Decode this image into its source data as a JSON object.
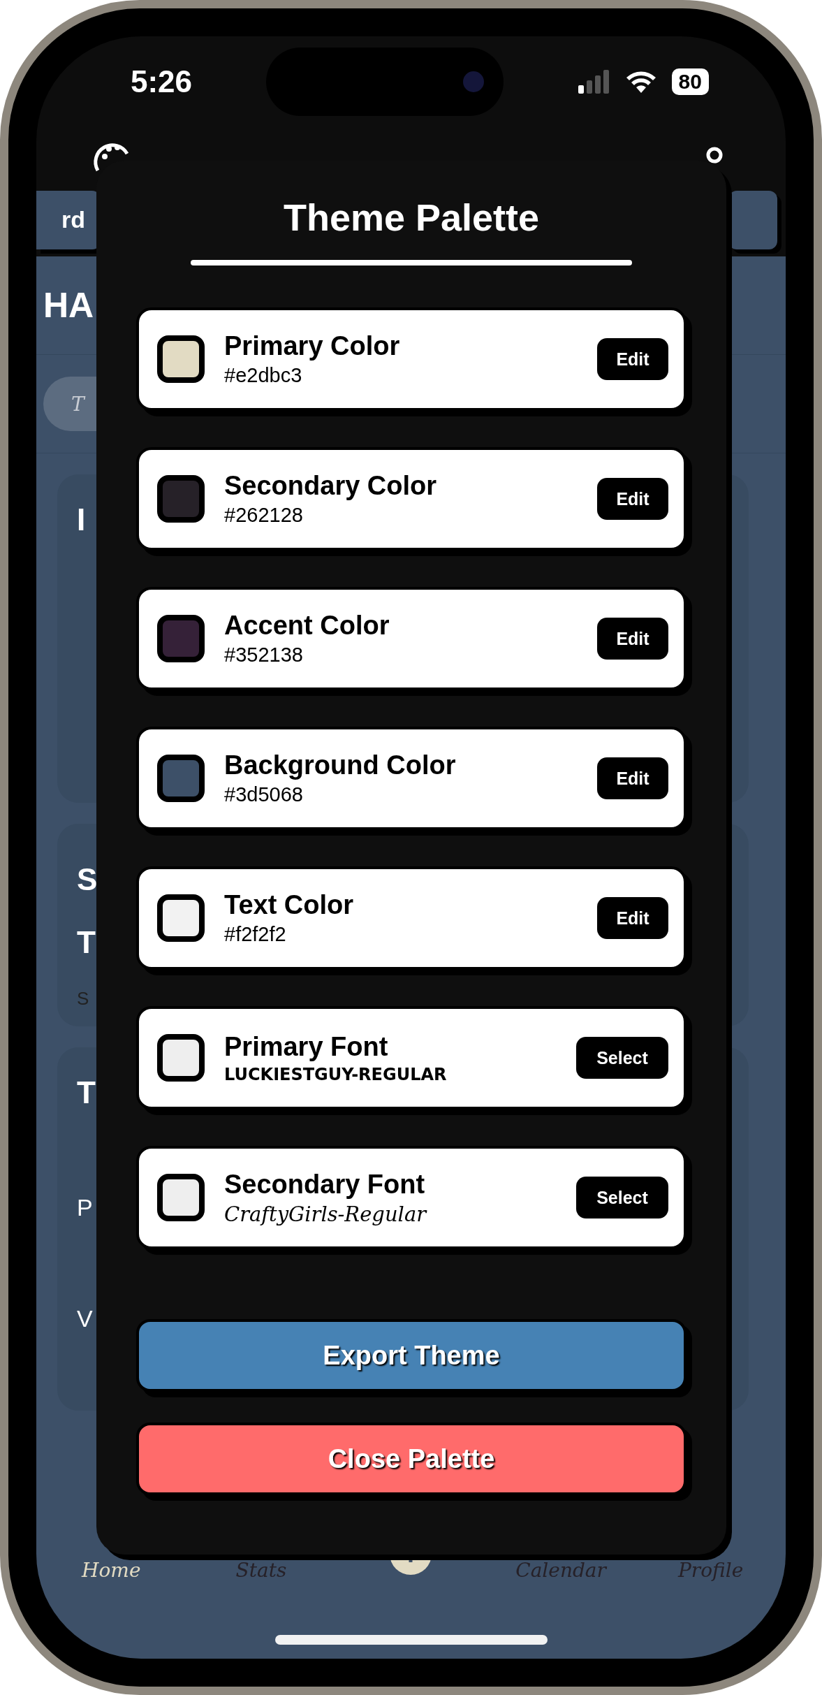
{
  "status_bar": {
    "time": "5:26",
    "battery": "80"
  },
  "background": {
    "chip_left": "rd",
    "heading": "HA",
    "search_fragment": "T",
    "cards": [
      {
        "lines": [
          "I"
        ]
      },
      {
        "lines": [
          "S",
          "T",
          "S"
        ]
      },
      {
        "lines": [
          "T",
          "P",
          "V"
        ]
      }
    ]
  },
  "modal": {
    "title": "Theme Palette",
    "rows": [
      {
        "kind": "color",
        "label": "Primary Color",
        "value": "#e2dbc3",
        "color": "#e2dbc3",
        "button": "Edit"
      },
      {
        "kind": "color",
        "label": "Secondary Color",
        "value": "#262128",
        "color": "#262128",
        "button": "Edit"
      },
      {
        "kind": "color",
        "label": "Accent Color",
        "value": "#352138",
        "color": "#352138",
        "button": "Edit"
      },
      {
        "kind": "color",
        "label": "Background Color",
        "value": "#3d5068",
        "color": "#3d5068",
        "button": "Edit"
      },
      {
        "kind": "color",
        "label": "Text Color",
        "value": "#f2f2f2",
        "color": "#f2f2f2",
        "button": "Edit"
      },
      {
        "kind": "font",
        "label": "Primary Font",
        "value": "LUCKIESTGUY-REGULAR",
        "color": "#eeeeee",
        "button": "Select"
      },
      {
        "kind": "font",
        "label": "Secondary Font",
        "value": "CraftyGirls-Regular",
        "color": "#eeeeee",
        "button": "Select"
      }
    ],
    "export_button": "Export Theme",
    "close_button": "Close Palette"
  },
  "tab_bar": [
    {
      "kind": "tab",
      "label": "Home",
      "selected": true
    },
    {
      "kind": "tab",
      "label": "Stats",
      "selected": false
    },
    {
      "kind": "add"
    },
    {
      "kind": "tab",
      "label": "Calendar",
      "selected": false
    },
    {
      "kind": "tab",
      "label": "Profile",
      "selected": false
    }
  ]
}
